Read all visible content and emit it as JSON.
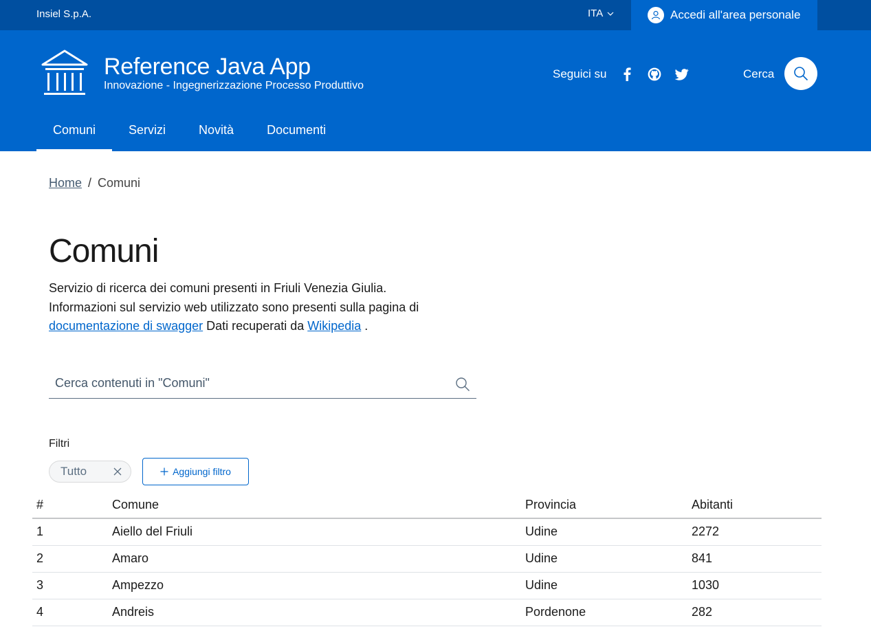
{
  "slim": {
    "org": "Insiel S.p.A.",
    "language": "ITA",
    "login_label": "Accedi all'area personale"
  },
  "header": {
    "title": "Reference Java App",
    "subtitle": "Innovazione - Ingegnerizzazione Processo Produttivo",
    "social_label": "Seguici su",
    "social_icons": [
      "facebook-icon",
      "github-icon",
      "twitter-icon"
    ],
    "search_label": "Cerca"
  },
  "nav": {
    "items": [
      {
        "label": "Comuni",
        "active": true
      },
      {
        "label": "Servizi"
      },
      {
        "label": "Novità"
      },
      {
        "label": "Documenti"
      }
    ]
  },
  "breadcrumb": {
    "home": "Home",
    "separator": "/",
    "current": "Comuni"
  },
  "main": {
    "title": "Comuni",
    "desc_line1": "Servizio di ricerca dei comuni presenti in Friuli Venezia Giulia.",
    "desc_line2": "Informazioni sul servizio web utilizzato sono presenti sulla pagina di",
    "link_swagger": "documentazione di swagger",
    "desc_mid": "Dati recuperati da",
    "link_wiki": "Wikipedia",
    "desc_end": "."
  },
  "search": {
    "placeholder": "Cerca contenuti in \"Comuni\""
  },
  "filters": {
    "label": "Filtri",
    "chip": "Tutto",
    "add_label": "Aggiungi filtro"
  },
  "table": {
    "headers": [
      "#",
      "Comune",
      "Provincia",
      "Abitanti"
    ],
    "rows": [
      [
        "1",
        "Aiello del Friuli",
        "Udine",
        "2272"
      ],
      [
        "2",
        "Amaro",
        "Udine",
        "841"
      ],
      [
        "3",
        "Ampezzo",
        "Udine",
        "1030"
      ],
      [
        "4",
        "Andreis",
        "Pordenone",
        "282"
      ]
    ]
  },
  "colors": {
    "primary": "#0066cc",
    "slim_bg": "#004fa0"
  }
}
